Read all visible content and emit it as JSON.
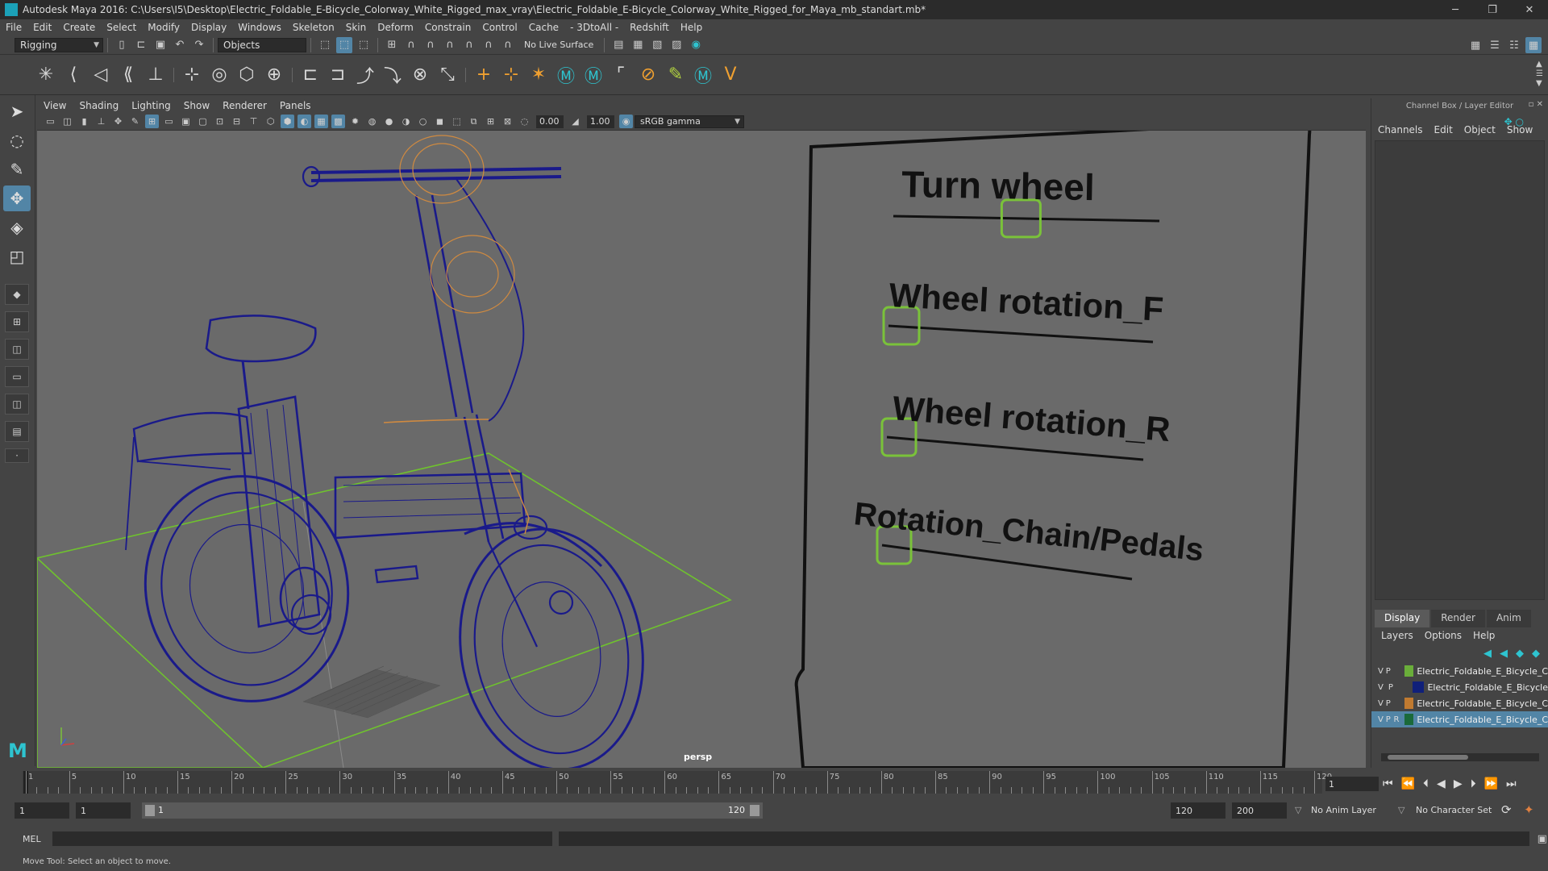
{
  "window": {
    "title": "Autodesk Maya 2016: C:\\Users\\I5\\Desktop\\Electric_Foldable_E-Bicycle_Colorway_White_Rigged_max_vray\\Electric_Foldable_E-Bicycle_Colorway_White_Rigged_for_Maya_mb_standart.mb*",
    "minimize": "─",
    "maximize": "❐",
    "close": "✕"
  },
  "menu": [
    "File",
    "Edit",
    "Create",
    "Select",
    "Modify",
    "Display",
    "Windows",
    "Skeleton",
    "Skin",
    "Deform",
    "Constrain",
    "Control",
    "Cache",
    "- 3DtoAll -",
    "Redshift",
    "Help"
  ],
  "statusline": {
    "mode": "Rigging",
    "selection_mask": "Objects",
    "live_surface": "No Live Surface"
  },
  "viewport": {
    "menu": [
      "View",
      "Shading",
      "Lighting",
      "Show",
      "Renderer",
      "Panels"
    ],
    "exposure": "0.00",
    "gamma": "1.00",
    "color_space": "sRGB gamma",
    "camera": "persp",
    "rig_panel": {
      "labels": [
        "Turn wheel",
        "Wheel rotation_F",
        "Wheel rotation_R",
        "Rotation_Chain/Pedals"
      ],
      "slider_positions": [
        0.48,
        0.0,
        0.0,
        0.0
      ]
    }
  },
  "channel_box": {
    "header": "Channel Box / Layer Editor",
    "menu": [
      "Channels",
      "Edit",
      "Object",
      "Show"
    ]
  },
  "layer_editor": {
    "tabs": [
      "Display",
      "Render",
      "Anim"
    ],
    "active_tab": "Display",
    "menu": [
      "Layers",
      "Options",
      "Help"
    ],
    "layers": [
      {
        "v": "V",
        "p": "P",
        "r": "",
        "name": "Electric_Foldable_E_Bicycle_C",
        "color": "#6aae3a",
        "selected": false
      },
      {
        "v": "V",
        "p": "P",
        "r": "",
        "name": "Electric_Foldable_E_Bicycle",
        "color": "#10207a",
        "selected": false
      },
      {
        "v": "V",
        "p": "P",
        "r": "",
        "name": "Electric_Foldable_E_Bicycle_C",
        "color": "#c07a30",
        "selected": false
      },
      {
        "v": "V",
        "p": "P",
        "r": "R",
        "name": "Electric_Foldable_E_Bicycle_C",
        "color": "#1a6a3a",
        "selected": true
      }
    ]
  },
  "timeline": {
    "ticks": [
      1,
      5,
      10,
      15,
      20,
      25,
      30,
      35,
      40,
      45,
      50,
      55,
      60,
      65,
      70,
      75,
      80,
      85,
      90,
      95,
      100,
      105,
      110,
      115,
      120
    ],
    "current_frame": "1",
    "start": 1,
    "end": 120
  },
  "range": {
    "start_frame": "1",
    "playback_start": "1",
    "slider_start_label": "1",
    "slider_end_label": "120",
    "playback_end": "120",
    "end_frame": "200",
    "anim_layer": "No Anim Layer",
    "character_set": "No Character Set"
  },
  "command_line": {
    "language": "MEL"
  },
  "help_line": "Move Tool: Select an object to move."
}
